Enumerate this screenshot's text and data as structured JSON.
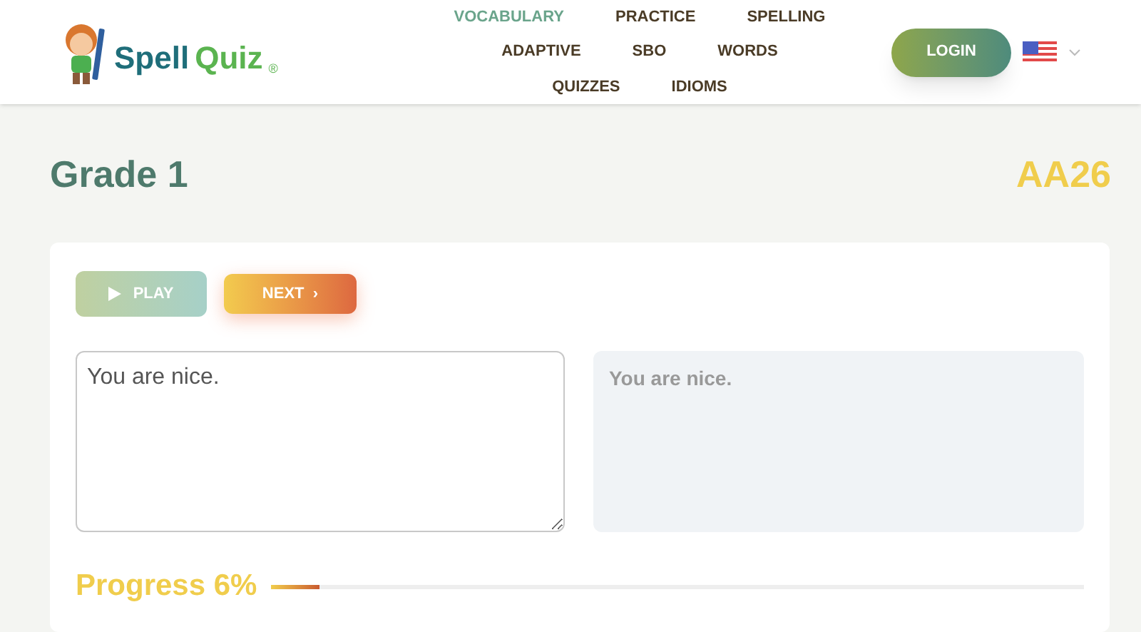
{
  "header": {
    "logo": {
      "word_1": "Spell",
      "word_2": "Quiz",
      "mark": "®"
    },
    "nav": [
      {
        "label": "VOCABULARY",
        "selected": true
      },
      {
        "label": "PRACTICE",
        "selected": false
      },
      {
        "label": "SPELLING",
        "selected": false
      },
      {
        "label": "ADAPTIVE",
        "selected": false
      },
      {
        "label": "SBO",
        "selected": false
      },
      {
        "label": "WORDS",
        "selected": false
      },
      {
        "label": "QUIZZES",
        "selected": false
      },
      {
        "label": "IDIOMS",
        "selected": false
      }
    ],
    "login": "LOGIN"
  },
  "page": {
    "title": "Grade 1",
    "code": "AA26"
  },
  "quiz": {
    "play": "PLAY",
    "next": "NEXT",
    "next_glyph": "›",
    "answer": "You are nice.",
    "correct": "You are nice.",
    "progress": {
      "label": "Progress 6%",
      "level": 0.06
    }
  }
}
